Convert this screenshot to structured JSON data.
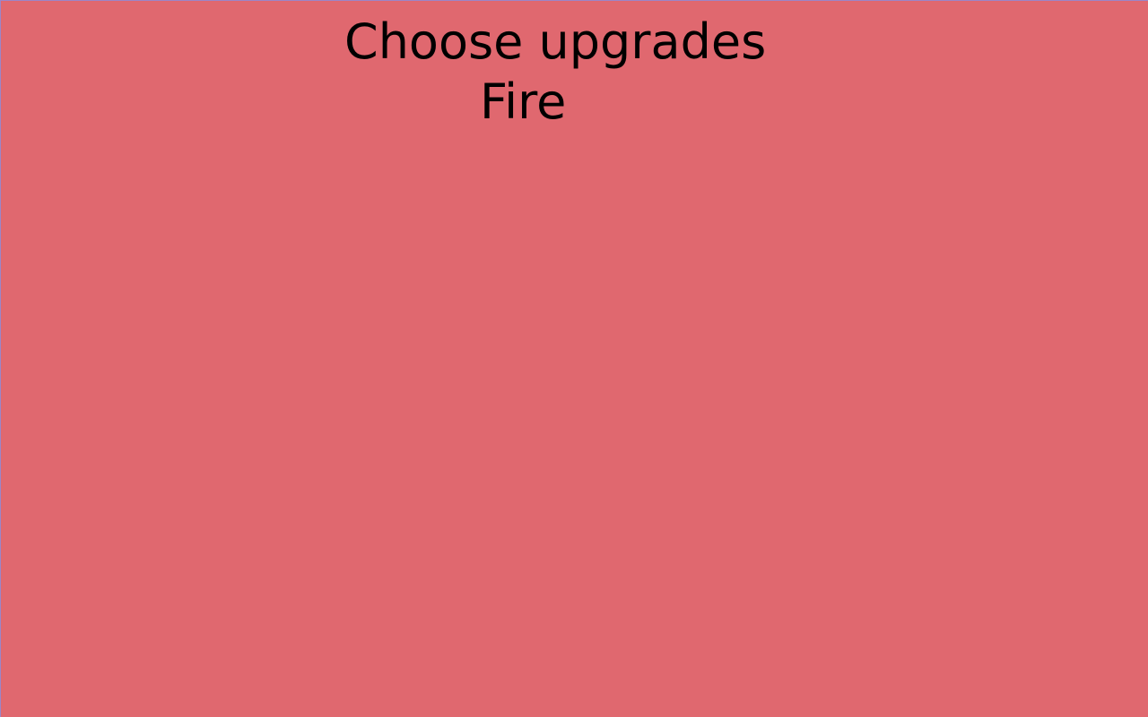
{
  "screen": {
    "background_color": "#e0686f",
    "title": "Choose upgrades"
  },
  "upgrades": [
    {
      "label": "Fire"
    }
  ]
}
